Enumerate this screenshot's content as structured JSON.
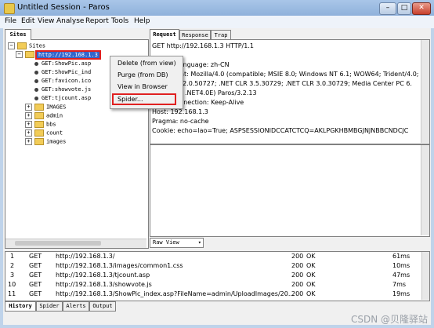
{
  "window": {
    "title": "Untitled Session - Paros",
    "buttons": [
      "–",
      "□",
      "✕"
    ]
  },
  "menu": [
    "File",
    "Edit",
    "View",
    "Analyse",
    "Report",
    "Tools",
    "Help"
  ],
  "left_panel": {
    "tab": "Sites"
  },
  "tree": {
    "root": "Sites",
    "host": "http://192.168.1.3",
    "children": [
      "GET:ShowPic.asp",
      "GET:ShowPic_ind",
      "GET:favicon.ico",
      "GET:showvote.js",
      "GET:tjcount.asp"
    ],
    "folders": [
      "IMAGES",
      "admin",
      "bbs",
      "count",
      "images"
    ]
  },
  "context_menu": [
    "Delete (from view)",
    "Purge (from DB)",
    "View in Browser",
    "Spider..."
  ],
  "right_tabs": [
    "Request",
    "Response",
    "Trap"
  ],
  "request_lines": [
    "GET http://192.168.1.3 HTTP/1.1",
    "",
    "Accept-Language: zh-CN",
    "User-Agent: Mozilla/4.0 (compatible; MSIE 8.0; Windows NT 6.1; WOW64; Trident/4.0; SLC",
    ".NET CLR 2.0.50727; .NET CLR 3.5.30729; .NET CLR 3.0.30729; Media Center PC 6.",
    ".NET4.0C; .NET4.0E) Paros/3.2.13",
    "Proxy-Connection: Keep-Alive",
    "Host: 192.168.1.3",
    "Pragma: no-cache",
    "Cookie: echo=lao=True; ASPSESSIONIDCCATCTCQ=AKLPGKHBMBGJNJNBBCNDCJC"
  ],
  "view_select": "Raw View",
  "history": [
    {
      "id": "1",
      "method": "GET",
      "url": "http://192.168.1.3/",
      "code": "200",
      "reason": "OK",
      "time": "61ms"
    },
    {
      "id": "2",
      "method": "GET",
      "url": "http://192.168.1.3/images/common1.css",
      "code": "200",
      "reason": "OK",
      "time": "10ms"
    },
    {
      "id": "3",
      "method": "GET",
      "url": "http://192.168.1.3/tjcount.asp",
      "code": "200",
      "reason": "OK",
      "time": "47ms"
    },
    {
      "id": "10",
      "method": "GET",
      "url": "http://192.168.1.3/showvote.js",
      "code": "200",
      "reason": "OK",
      "time": "7ms"
    },
    {
      "id": "11",
      "method": "GET",
      "url": "http://192.168.1.3/ShowPic_index.asp?FileName=admin/UploadImages/20...",
      "code": "200",
      "reason": "OK",
      "time": "19ms"
    }
  ],
  "bottom_tabs": [
    "History",
    "Spider",
    "Alerts",
    "Output"
  ],
  "watermark": "CSDN @贝隆驿站"
}
